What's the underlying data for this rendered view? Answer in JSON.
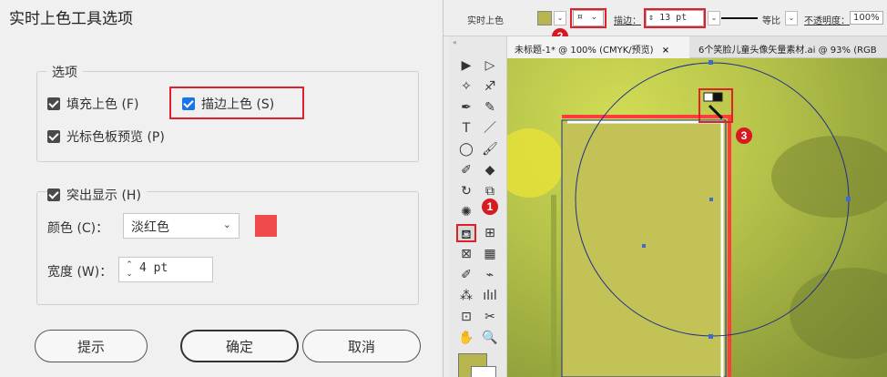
{
  "dialog": {
    "title": "实时上色工具选项",
    "options_group": {
      "title": "选项",
      "fill_label": "填充上色 (F)",
      "stroke_label": "描边上色 (S)",
      "preview_label": "光标色板预览 (P)"
    },
    "highlight_group": {
      "title": "突出显示 (H)",
      "color_label": "颜色 (C)：",
      "color_value": "淡红色",
      "width_label": "宽度 (W)：",
      "width_value": "4 pt"
    },
    "buttons": {
      "tips": "提示",
      "ok": "确定",
      "cancel": "取消"
    },
    "colors": {
      "highlight_swatch": "#f04b4b",
      "annotation_red": "#e0202a",
      "checkbox_blue": "#1a73e8"
    }
  },
  "illustrator": {
    "control_bar": {
      "title": "实时上色",
      "stroke_style": "¤",
      "stroke_label": "描边：",
      "stroke_weight": "13 pt",
      "profile_label": "等比",
      "opacity_label": "不透明度：",
      "opacity_value": "100%",
      "fill_swatch_color": "#b7b64e"
    },
    "tabs": [
      {
        "label": "未标题-1* @ 100% (CMYK/预览)",
        "close": "×"
      },
      {
        "label": "6个笑脸儿童头像矢量素材.ai @ 93% (RGB"
      }
    ],
    "toolbar": {
      "handle": "«",
      "tools": [
        {
          "name": "selection-tool",
          "glyph": "▶"
        },
        {
          "name": "direct-selection-tool",
          "glyph": "▷"
        },
        {
          "name": "magic-wand-tool",
          "glyph": "✧"
        },
        {
          "name": "lasso-tool",
          "glyph": "♐"
        },
        {
          "name": "pen-tool",
          "glyph": "✒"
        },
        {
          "name": "curvature-tool",
          "glyph": "✎"
        },
        {
          "name": "type-tool",
          "glyph": "T"
        },
        {
          "name": "line-tool",
          "glyph": "／"
        },
        {
          "name": "ellipse-tool",
          "glyph": "◯"
        },
        {
          "name": "paintbrush-tool",
          "glyph": "🖌"
        },
        {
          "name": "shaper-tool",
          "glyph": "✐"
        },
        {
          "name": "eraser-tool",
          "glyph": "◆"
        },
        {
          "name": "rotate-tool",
          "glyph": "↻"
        },
        {
          "name": "scale-tool",
          "glyph": "⧉"
        },
        {
          "name": "puppet-warp-tool",
          "glyph": "✺"
        },
        {
          "name": "free-transform-tool",
          "glyph": "⌗"
        },
        {
          "name": "live-paint-bucket-tool",
          "glyph": "⛾"
        },
        {
          "name": "perspective-grid-tool",
          "glyph": "⊞"
        },
        {
          "name": "mesh-tool",
          "glyph": "⊠"
        },
        {
          "name": "gradient-tool",
          "glyph": "▦"
        },
        {
          "name": "eyedropper-tool",
          "glyph": "✐"
        },
        {
          "name": "blend-tool",
          "glyph": "⌁"
        },
        {
          "name": "symbol-sprayer-tool",
          "glyph": "⁂"
        },
        {
          "name": "column-graph-tool",
          "glyph": "ılıl"
        },
        {
          "name": "artboard-tool",
          "glyph": "⊡"
        },
        {
          "name": "slice-tool",
          "glyph": "✂"
        },
        {
          "name": "hand-tool",
          "glyph": "✋"
        },
        {
          "name": "zoom-tool",
          "glyph": "🔍"
        }
      ]
    },
    "badges": {
      "one": "1",
      "two": "2",
      "three": "3"
    },
    "canvas": {
      "rect_fill": "#c2c257",
      "circle_stroke": "#1f2f8a",
      "highlight_stroke": "#ff3b3b"
    }
  }
}
